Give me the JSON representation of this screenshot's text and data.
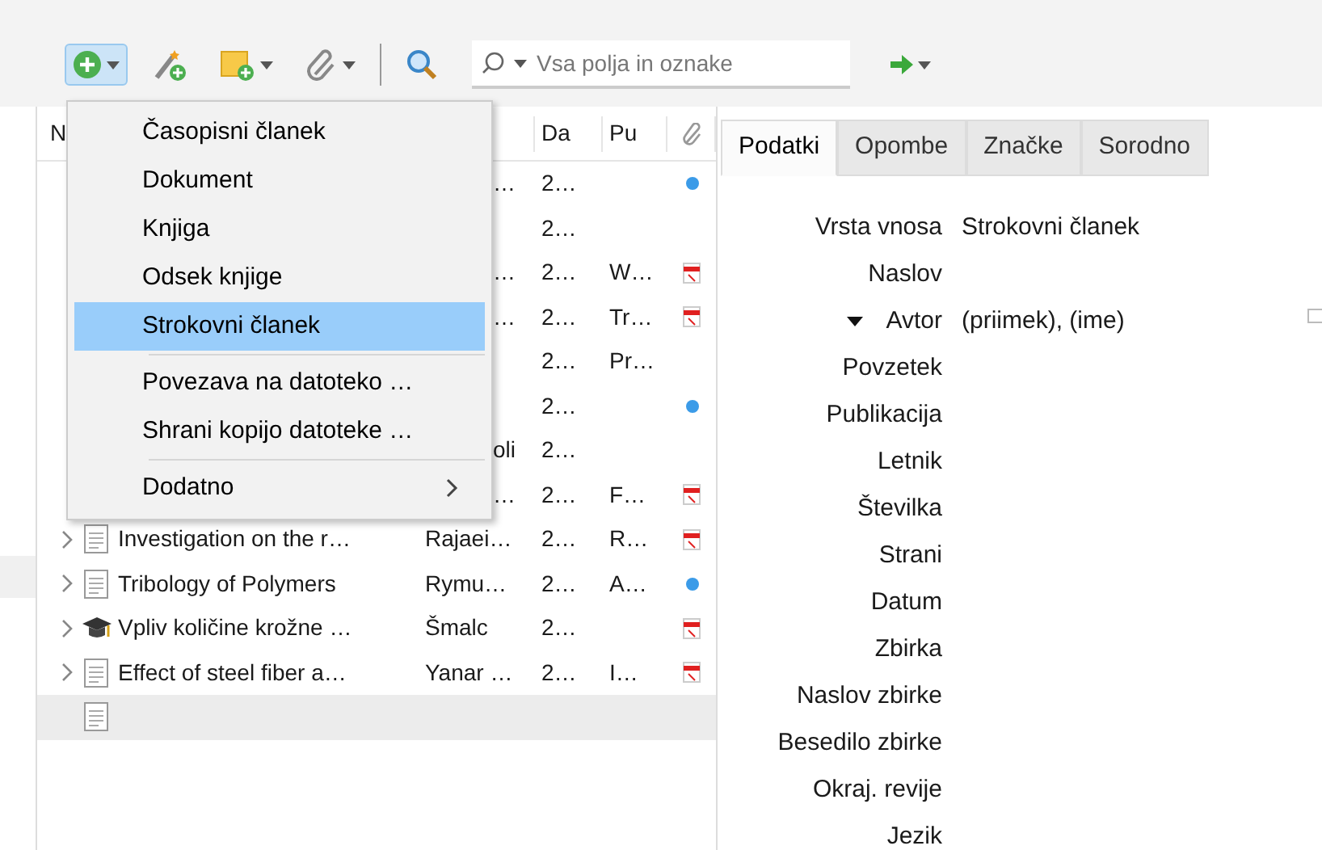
{
  "toolbar": {
    "new_item_button": {
      "expanded": true
    },
    "search": {
      "placeholder": "Vsa polja in oznake"
    }
  },
  "items_table": {
    "columns": [
      "N",
      "Da",
      "Pu"
    ],
    "rows": [
      {
        "creator": "…",
        "date": "2…",
        "publication": "",
        "attachment": {
          "kind": "link"
        },
        "selected": false
      },
      {
        "creator": "",
        "date": "2…",
        "publication": "",
        "selected": false
      },
      {
        "creator": "…",
        "date": "2…",
        "publication": "W…",
        "attachment": {
          "kind": "pdf"
        },
        "selected": false
      },
      {
        "creator": "…",
        "date": "2…",
        "publication": "Tr…",
        "attachment": {
          "kind": "pdf"
        },
        "selected": false
      },
      {
        "creator": "",
        "date": "2…",
        "publication": "Pr…",
        "selected": false
      },
      {
        "creator": "",
        "date": "2…",
        "publication": "",
        "attachment": {
          "kind": "link"
        },
        "selected": false
      },
      {
        "creator": "oli",
        "date": "2…",
        "publication": "",
        "selected": false
      },
      {
        "creator": "…",
        "date": "2…",
        "publication": "F…",
        "attachment": {
          "kind": "pdf"
        },
        "selected": false
      },
      {
        "kind": "document",
        "has_children": true,
        "title": "Investigation on the r…",
        "creator": "Rajaei…",
        "date": "2…",
        "publication": "R…",
        "attachment": {
          "kind": "pdf"
        },
        "selected": false
      },
      {
        "kind": "document",
        "has_children": true,
        "title": "Tribology of Polymers",
        "creator": "Rymu…",
        "date": "2…",
        "publication": "A…",
        "attachment": {
          "kind": "link"
        },
        "selected": false
      },
      {
        "kind": "thesis",
        "has_children": true,
        "title": "Vpliv količine krožne …",
        "creator": "Šmalc",
        "date": "2…",
        "publication": "",
        "attachment": {
          "kind": "pdf"
        },
        "selected": false
      },
      {
        "kind": "document",
        "has_children": true,
        "title": "Effect of steel fiber a…",
        "creator": "Yanar …",
        "date": "2…",
        "publication": "I…",
        "attachment": {
          "kind": "pdf"
        },
        "selected": false
      },
      {
        "kind": "document",
        "has_children": false,
        "title": "",
        "creator": "",
        "date": "",
        "publication": "",
        "selected": true
      }
    ]
  },
  "new_item_menu": {
    "items": [
      {
        "kind": "item",
        "label": "Časopisni članek",
        "selected": false
      },
      {
        "kind": "item",
        "label": "Dokument",
        "selected": false
      },
      {
        "kind": "item",
        "label": "Knjiga",
        "selected": false
      },
      {
        "kind": "item",
        "label": "Odsek knjige",
        "selected": false
      },
      {
        "kind": "item",
        "label": "Strokovni članek",
        "selected": true
      },
      {
        "kind": "separator"
      },
      {
        "kind": "item",
        "label": "Povezava na datoteko …",
        "selected": false
      },
      {
        "kind": "item",
        "label": "Shrani kopijo datoteke …",
        "selected": false
      },
      {
        "kind": "separator"
      },
      {
        "kind": "submenu",
        "label": "Dodatno",
        "selected": false
      }
    ]
  },
  "item_pane": {
    "tabs": [
      {
        "label": "Podatki",
        "selected": true
      },
      {
        "label": "Opombe",
        "selected": false
      },
      {
        "label": "Značke",
        "selected": false
      },
      {
        "label": "Sorodno",
        "selected": false
      }
    ],
    "fields": [
      {
        "label": "Vrsta vnosa",
        "value": "Strokovni članek"
      },
      {
        "label": "Naslov"
      },
      {
        "label": "Avtor",
        "value": "(priimek), (ime)",
        "expander": true
      },
      {
        "label": "Povzetek"
      },
      {
        "label": "Publikacija"
      },
      {
        "label": "Letnik"
      },
      {
        "label": "Številka"
      },
      {
        "label": "Strani"
      },
      {
        "label": "Datum"
      },
      {
        "label": "Zbirka"
      },
      {
        "label": "Naslov zbirke"
      },
      {
        "label": "Besedilo zbirke"
      },
      {
        "label": "Okraj. revije"
      },
      {
        "label": "Jezik"
      }
    ]
  }
}
